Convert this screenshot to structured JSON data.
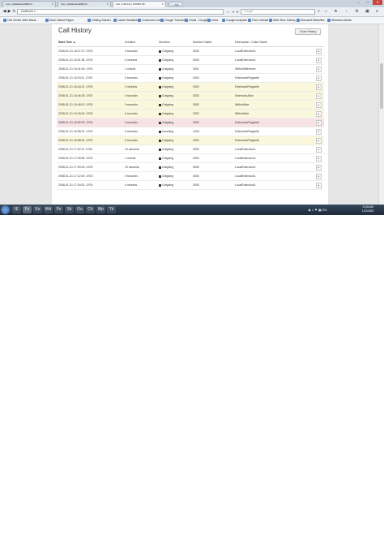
{
  "browser": {
    "tabs": [
      {
        "label": "Foo | HullabalooWEB.Gr..."
      },
      {
        "label": "Foo | HullabalooWEB.Gr..."
      },
      {
        "label": "Foo | Call Info | M7PBX Mt..."
      }
    ],
    "new_tab_label": "+ Tab",
    "window_controls": {
      "minimize": "–",
      "maximize": "□",
      "close": "✕"
    },
    "nav": {
      "back": "◀",
      "forward": "▶",
      "refresh": "↻"
    },
    "url": "localhost/ c...",
    "search_placeholder": "Google",
    "bookmarks": [
      "Call Center Web Mana...",
      "Most Visited Pages",
      "Getting Started",
      "Latest Headlines",
      "Customize Links",
      "Google Translate",
      "Gmail - Google",
      "Inbox",
      "Google Analytics",
      "Free Hotmail",
      "Web Slice Gallery",
      "Microsoft Websites",
      "Windows Media"
    ]
  },
  "dialog": {
    "title": "Call History",
    "close_label": "Close History",
    "columns": [
      "Start Time ▲",
      "Duration",
      "Direction",
      "Number Dialed",
      "Description / Caller Name",
      ""
    ],
    "rows": [
      {
        "start": "2008-01-21 16:27:27 -0700",
        "duration": "0 seconds",
        "direction": "Outgoing",
        "number": "3000",
        "description": "LocalExtension1",
        "highlight": "none"
      },
      {
        "start": "2008-01-21 16:31:36 -0700",
        "duration": "4 minutes",
        "direction": "Outgoing",
        "number": "3000",
        "description": "LocalExtension1",
        "highlight": "none"
      },
      {
        "start": "2008-01-21 16:41:06 -0700",
        "duration": "1 minute",
        "direction": "Outgoing",
        "number": "3001",
        "description": "WithinDifference",
        "highlight": "none"
      },
      {
        "start": "2008-01-21 16:43:11 -0700",
        "duration": "0 seconds",
        "direction": "Outgoing",
        "number": "3002",
        "description": "ExtensionRingwrite",
        "highlight": "none"
      },
      {
        "start": "2008-01-21 16:44:21 -0700",
        "duration": "2 minutes",
        "direction": "Outgoing",
        "number": "3002",
        "description": "ExtensionRingwrite",
        "highlight": "yellow"
      },
      {
        "start": "2008-01-21 16:46:28 -0700",
        "duration": "0 seconds",
        "direction": "Outgoing",
        "number": "3002",
        "description": "ExtensionAlive",
        "highlight": "yellow"
      },
      {
        "start": "2008-01-21 16:48:10 -0700",
        "duration": "0 seconds",
        "direction": "Outgoing",
        "number": "3002",
        "description": "WithinAlive",
        "highlight": "yellow"
      },
      {
        "start": "2008-01-21 16:49:42 -0700",
        "duration": "0 seconds",
        "direction": "Outgoing",
        "number": "3002",
        "description": "WithinAlive",
        "highlight": "yellow"
      },
      {
        "start": "2008-01-21 16:52:09 -0700",
        "duration": "0 seconds",
        "direction": "Outgoing",
        "number": "3002",
        "description": "ExtensionRingwrite",
        "highlight": "pink"
      },
      {
        "start": "2008-01-21 16:55:31 -0700",
        "duration": "0 seconds",
        "direction": "Incoming",
        "number": "1234",
        "description": "ExtensionRingwrite",
        "highlight": "none"
      },
      {
        "start": "2008-01-21 16:58:44 -0700",
        "duration": "0 seconds",
        "direction": "Outgoing",
        "number": "3000",
        "description": "ExtensionRingwrite",
        "highlight": "yellow"
      },
      {
        "start": "2008-01-21 17:02:11 -0700",
        "duration": "10 seconds",
        "direction": "Outgoing",
        "number": "3000",
        "description": "LocalExtension1",
        "highlight": "none"
      },
      {
        "start": "2008-01-21 17:05:56 -0700",
        "duration": "1 minute",
        "direction": "Outgoing",
        "number": "3000",
        "description": "LocalExtension1",
        "highlight": "none"
      },
      {
        "start": "2008-01-21 17:09:23 -0700",
        "duration": "10 seconds",
        "direction": "Outgoing",
        "number": "3000",
        "description": "LocalExtension1",
        "highlight": "none"
      },
      {
        "start": "2008-01-21 17:12:40 -0700",
        "duration": "0 seconds",
        "direction": "Outgoing",
        "number": "3000",
        "description": "LocalExtension1",
        "highlight": "none"
      },
      {
        "start": "2008-01-21 17:16:02 -0700",
        "duration": "4 minutes",
        "direction": "Outgoing",
        "number": "3000",
        "description": "LocalExtension1",
        "highlight": "none"
      }
    ]
  },
  "taskbar": {
    "items": [
      "IE",
      "Fx",
      "Ex",
      "Wd",
      "Ps",
      "Sk",
      "Ou",
      "Ch",
      "Mp",
      "Tk"
    ],
    "tray": "◀ ♫ ⚑ ▣ EN",
    "time": "10:53 AM",
    "date": "1/22/2008"
  },
  "colors": {
    "highlight_yellow": "#fbf7dc",
    "highlight_pink": "#f7e3e6",
    "taskbar": "#1d2a3a"
  }
}
